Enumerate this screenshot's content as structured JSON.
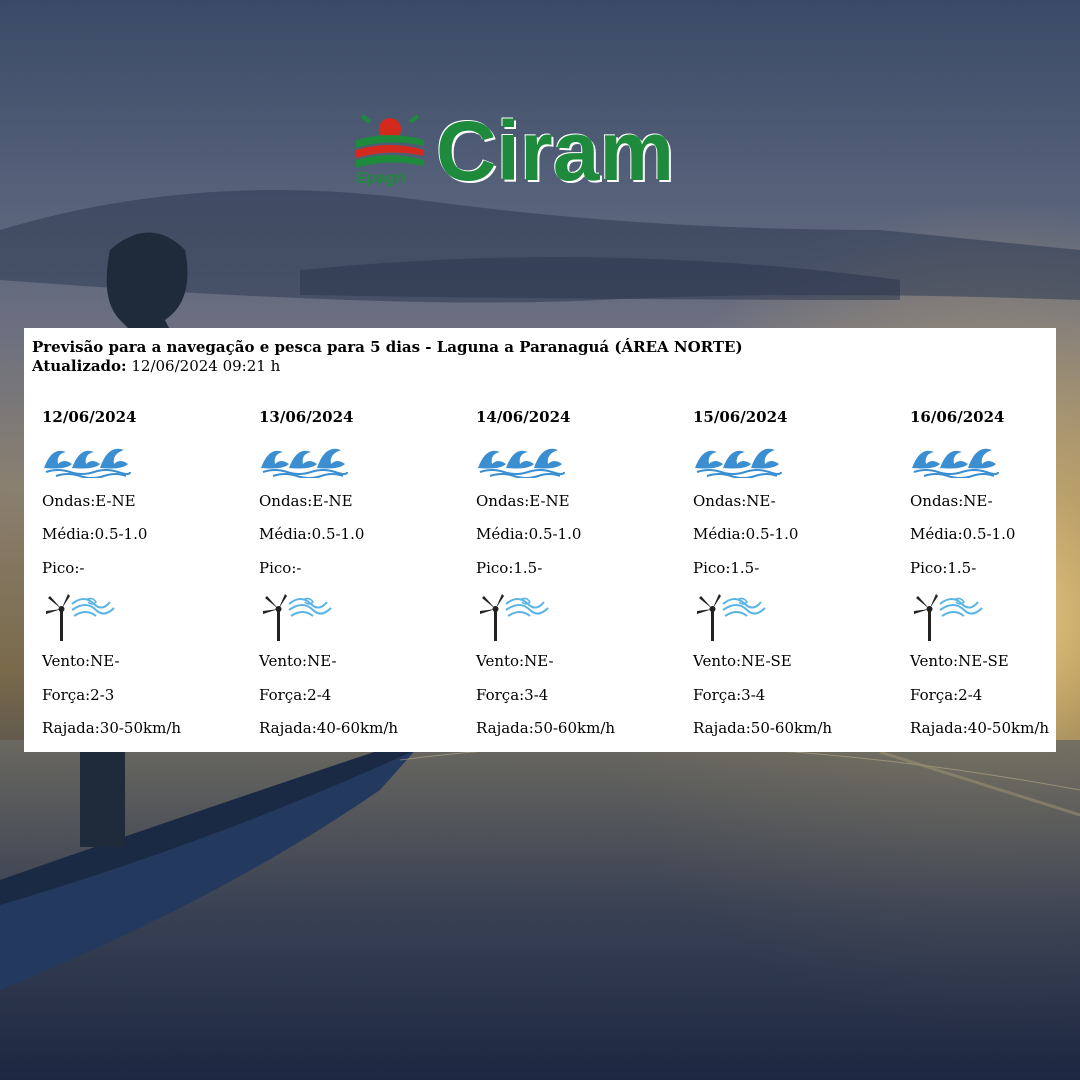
{
  "logo": {
    "small_text": "Epagri",
    "brand_text": "Ciram",
    "colors": {
      "green": "#1e8a3c",
      "red": "#d42a1e"
    }
  },
  "panel": {
    "title": "Previsão para a navegação e pesca para 5 dias - Laguna a Paranaguá (ÁREA NORTE)",
    "updated_label": "Atualizado:",
    "updated_value": "12/06/2024 09:21 h"
  },
  "days": [
    {
      "date": "12/06/2024",
      "wave_icon": "waves-icon",
      "ondas": "Ondas:E-NE",
      "media": "Média:0.5-1.0",
      "pico": "Pico:-",
      "wind_icon": "wind-turbine-icon",
      "vento": "Vento:NE-",
      "forca": "Força:2-3",
      "rajada": "Rajada:30-50km/h"
    },
    {
      "date": "13/06/2024",
      "wave_icon": "waves-icon",
      "ondas": "Ondas:E-NE",
      "media": "Média:0.5-1.0",
      "pico": "Pico:-",
      "wind_icon": "wind-turbine-icon",
      "vento": "Vento:NE-",
      "forca": "Força:2-4",
      "rajada": "Rajada:40-60km/h"
    },
    {
      "date": "14/06/2024",
      "wave_icon": "waves-icon",
      "ondas": "Ondas:E-NE",
      "media": "Média:0.5-1.0",
      "pico": "Pico:1.5-",
      "wind_icon": "wind-turbine-icon",
      "vento": "Vento:NE-",
      "forca": "Força:3-4",
      "rajada": "Rajada:50-60km/h"
    },
    {
      "date": "15/06/2024",
      "wave_icon": "waves-icon",
      "ondas": "Ondas:NE-",
      "media": "Média:0.5-1.0",
      "pico": "Pico:1.5-",
      "wind_icon": "wind-turbine-icon",
      "vento": "Vento:NE-SE",
      "forca": "Força:3-4",
      "rajada": "Rajada:50-60km/h"
    },
    {
      "date": "16/06/2024",
      "wave_icon": "waves-icon",
      "ondas": "Ondas:NE-",
      "media": "Média:0.5-1.0",
      "pico": "Pico:1.5-",
      "wind_icon": "wind-turbine-icon",
      "vento": "Vento:NE-SE",
      "forca": "Força:2-4",
      "rajada": "Rajada:40-50km/h"
    }
  ]
}
